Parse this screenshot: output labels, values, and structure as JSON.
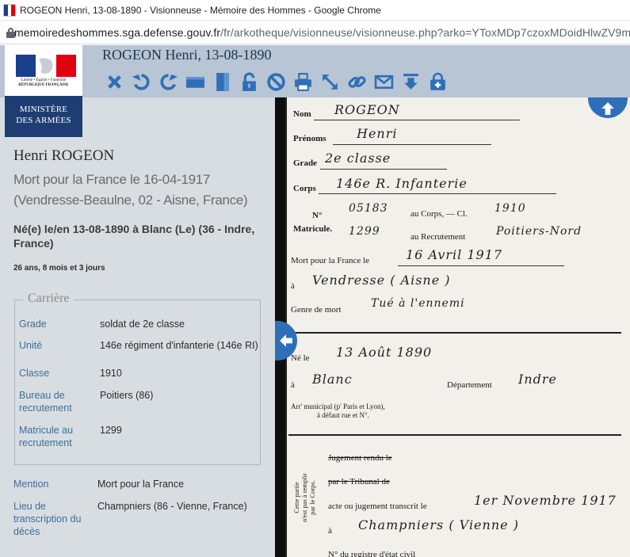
{
  "browser": {
    "tab_title": "ROGEON Henri, 13-08-1890 - Visionneuse - Mémoire des Hommes - Google Chrome",
    "url_domain": "memoiredeshommes.sga.defense.gouv.fr",
    "url_path": "/fr/arkotheque/visionneuse/visionneuse.php?arko=YToxMDp7czoxMDoidHlwZV9m"
  },
  "logo": {
    "motto": "Liberté • Égalité • Fraternité",
    "republic": "RÉPUBLIQUE FRANÇAISE",
    "ministry_line1": "MINISTÈRE",
    "ministry_line2": "DES ARMÉES",
    "colors": {
      "blue": "#1e3e73",
      "flag_blue": "#1b3f8c",
      "flag_white": "#ffffff",
      "flag_red": "#e1000f"
    }
  },
  "viewer": {
    "title": "ROGEON Henri, 13-08-1890",
    "toolbar": [
      "close-icon",
      "rotate-left-icon",
      "rotate-right-icon",
      "fit-width-icon",
      "fit-height-icon",
      "unlock-icon",
      "block-icon",
      "print-icon",
      "expand-icon",
      "link-icon",
      "email-icon",
      "download-icon",
      "add-to-basket-icon"
    ]
  },
  "record": {
    "name": "Henri ROGEON",
    "death": "Mort pour la France le 16-04-1917 (Vendresse-Beaulne, 02 - Aisne, France)",
    "birth": "Né(e) le/en 13-08-1890 à Blanc (Le) (36 - Indre, France)",
    "age": "26 ans, 8 mois et 3 jours",
    "career_legend": "Carrière",
    "career": [
      {
        "label": "Grade",
        "value": "soldat de 2e classe"
      },
      {
        "label": "Unité",
        "value": "146e régiment d'infanterie (146e RI)"
      },
      {
        "label": "Classe",
        "value": "1910"
      },
      {
        "label": "Bureau de recrutement",
        "value": "Poitiers (86)"
      },
      {
        "label": "Matricule au recrutement",
        "value": "1299"
      }
    ],
    "mention": {
      "label": "Mention",
      "value": "Mort pour la France"
    },
    "transcription": {
      "label": "Lieu de transcription du décès",
      "value": "Champniers (86 - Vienne, France)"
    }
  },
  "document": {
    "nom_label": "Nom",
    "nom_value": "ROGEON",
    "prenoms_label": "Prénoms",
    "prenoms_value": "Henri",
    "grade_label": "Grade",
    "grade_value": "2e classe",
    "corps_label": "Corps",
    "corps_value": "146e R. Infanterie",
    "no_label": "N°",
    "matricule_label": "Matricule.",
    "corps_no": "05183",
    "au_corps_label": "au Corps, — Cl.",
    "classe_value": "1910",
    "recrut_no": "1299",
    "au_recrut_label": "au Recrutement",
    "recrut_value": "Poitiers-Nord",
    "mort_label": "Mort pour la France le",
    "mort_value": "16 Avril 1917",
    "a_label": "à",
    "lieu_mort": "Vendresse ( Aisne )",
    "genre_label": "Genre de mort",
    "genre_value": "Tué à l'ennemi",
    "ne_label": "Né le",
    "ne_value": "13 Août 1890",
    "a2_label": "à",
    "lieu_ne": "Blanc",
    "dept_label": "Département",
    "dept_value": "Indre",
    "arr_label": "Arr' municipal (p' Paris et Lyon),",
    "arr_label2": "à défaut rue et N°.",
    "side_note1": "Cette partie",
    "side_note2": "n'est pas à remplir",
    "side_note3": "par le Corps.",
    "jugement1": "Jugement rendu le",
    "jugement2": "par le Tribunal de",
    "acte_label": "acte ou jugement transcrit le",
    "acte_date": "1er Novembre 1917",
    "a3_label": "à",
    "lieu_transcrit": "Champniers ( Vienne )",
    "registre_label": "N° du registre d'état civil"
  }
}
